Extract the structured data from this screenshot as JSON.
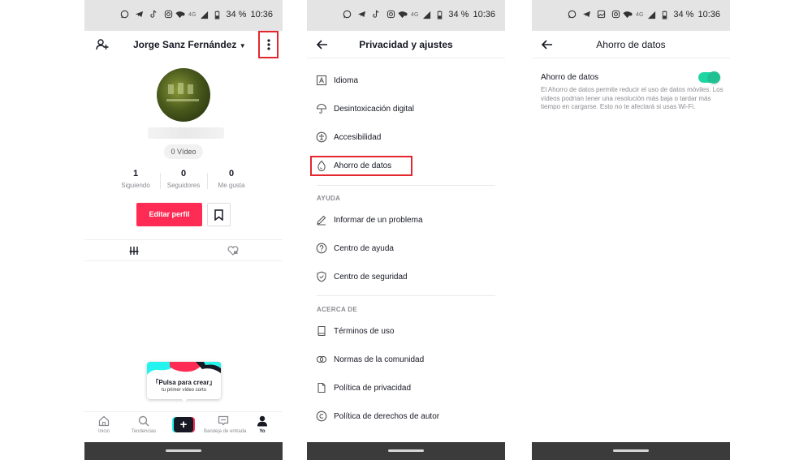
{
  "status_bar": {
    "screen1": {
      "battery": "34 %",
      "time": "10:36",
      "network": "4G"
    },
    "screen2": {
      "battery": "34 %",
      "time": "10:36",
      "network": "4G"
    },
    "screen3": {
      "battery": "34 %",
      "time": "10:36",
      "network": "4G"
    }
  },
  "profile": {
    "name": "Jorge Sanz Fernández",
    "name_dropdown_icon": "caret-down-icon",
    "add_friend_icon": "add-user-icon",
    "menu_icon": "more-vertical-icon",
    "video_count": "0 Vídeo",
    "stats": [
      {
        "value": "1",
        "label": "Siguiendo"
      },
      {
        "value": "0",
        "label": "Seguidores"
      },
      {
        "value": "0",
        "label": "Me gusta"
      }
    ],
    "edit_button": "Editar perfil",
    "create_tip": {
      "title": "「Pulsa para crear」",
      "subtitle": "tu primer vídeo corto"
    },
    "bottom_nav": [
      {
        "label": "Inicio",
        "icon": "home-icon"
      },
      {
        "label": "Tendencias",
        "icon": "search-icon"
      },
      {
        "label": "",
        "icon": "plus-icon"
      },
      {
        "label": "Bandeja de entrada",
        "icon": "inbox-icon"
      },
      {
        "label": "Yo",
        "icon": "profile-icon"
      }
    ],
    "highlight_color": "#e5262f",
    "accent_color": "#fe2c55"
  },
  "settings": {
    "title": "Privacidad y ajustes",
    "back_icon": "arrow-left-icon",
    "items_top": [
      {
        "label": "Idioma",
        "icon": "language-icon"
      },
      {
        "label": "Desintoxicación digital",
        "icon": "umbrella-icon"
      },
      {
        "label": "Accesibilidad",
        "icon": "accessibility-icon"
      },
      {
        "label": "Ahorro de datos",
        "icon": "water-drop-icon"
      }
    ],
    "section_help": "AYUDA",
    "items_help": [
      {
        "label": "Informar de un problema",
        "icon": "pencil-icon"
      },
      {
        "label": "Centro de ayuda",
        "icon": "help-icon"
      },
      {
        "label": "Centro de seguridad",
        "icon": "shield-icon"
      }
    ],
    "section_about": "ACERCA DE",
    "items_about": [
      {
        "label": "Términos de uso",
        "icon": "book-icon"
      },
      {
        "label": "Normas de la comunidad",
        "icon": "community-icon"
      },
      {
        "label": "Política de privacidad",
        "icon": "document-icon"
      },
      {
        "label": "Política de derechos de autor",
        "icon": "copyright-icon"
      }
    ]
  },
  "data_saver": {
    "title": "Ahorro de datos",
    "back_icon": "arrow-left-icon",
    "setting_label": "Ahorro de datos",
    "description": "El Ahorro de datos permite reducir el uso de datos móviles. Los vídeos podrían tener una resolución más baja o tardar más tiempo en cargarse. Esto no te afectará si usas Wi-Fi.",
    "enabled": true,
    "toggle_color": "#20d5a4"
  }
}
